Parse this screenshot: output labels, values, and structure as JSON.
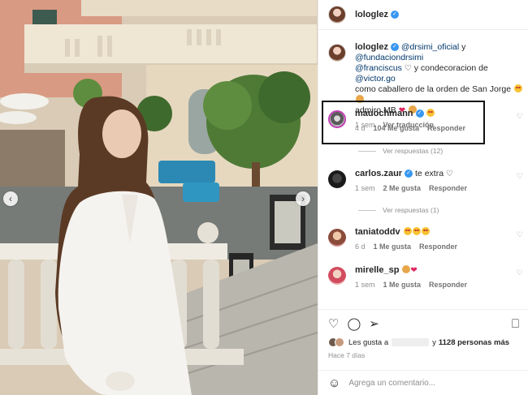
{
  "header": {
    "username": "lologlez"
  },
  "caption": {
    "username": "lologlez",
    "mention1": "@drsimi_oficial",
    "text1": " y ",
    "mention2": "@fundaciondrsimi",
    "mention3": "@franciscus",
    "text2": " y condecoracion de ",
    "mention4": "@victor.go",
    "text3": "como caballero de la orden de San Jorge",
    "text4": "admiro MB",
    "time": "1 sem",
    "see_translation": "Ver traducción"
  },
  "comments": [
    {
      "username": "mauochmann",
      "text": "",
      "time": "4 d",
      "likes": "104 Me gusta",
      "reply": "Responder",
      "replies": "Ver respuestas (12)",
      "emoji": "star-struck"
    },
    {
      "username": "carlos.zaur",
      "text": "te extra",
      "time": "1 sem",
      "likes": "2 Me gusta",
      "reply": "Responder",
      "replies": "Ver respuestas (1)"
    },
    {
      "username": "taniatoddv",
      "text": "",
      "time": "6 d",
      "likes": "1 Me gusta",
      "reply": "Responder",
      "emoji": "star-struck x3"
    },
    {
      "username": "mirelle_sp",
      "text": "",
      "time": "1 sem",
      "likes": "1 Me gusta",
      "reply": "Responder",
      "emoji": "clap-heart"
    }
  ],
  "actions": {
    "likes_prefix": "Les gusta a",
    "likes_suffix": "y",
    "likes_count": "1128 personas más",
    "date": "Hace 7 días"
  },
  "composer": {
    "placeholder": "Agrega un comentario..."
  },
  "icons": {
    "like": "heart-icon",
    "comment": "comment-icon",
    "share": "share-icon",
    "save": "bookmark-icon",
    "emoji": "emoji-icon",
    "prev": "chevron-left-icon",
    "next": "chevron-right-icon"
  },
  "colors": {
    "verified": "#3897f0",
    "link": "#00376b",
    "heart": "#e0245e",
    "muted": "#8e8e8e",
    "highlight_border": "#111111"
  }
}
